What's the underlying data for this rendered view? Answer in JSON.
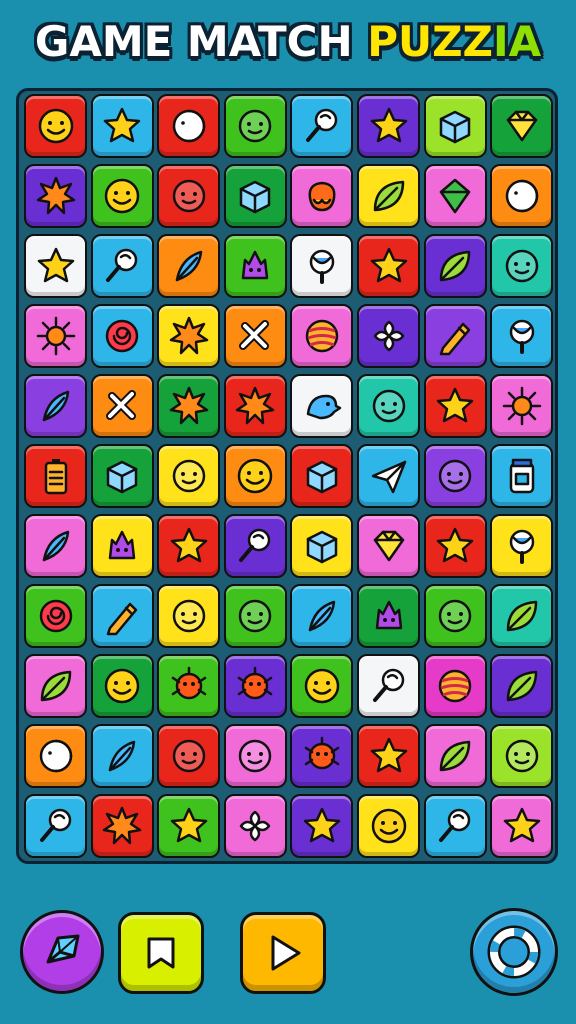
{
  "title": {
    "part1": "GAME MATCH ",
    "part2": "PUZZ",
    "part3": "IA"
  },
  "palette": {
    "red": "#e8261c",
    "sky": "#2fb6e8",
    "green": "#3fc11e",
    "dgreen": "#16a23a",
    "purple": "#6a2fd2",
    "violet": "#8a3fe0",
    "orange": "#ff8c12",
    "yellow": "#ffe21a",
    "pink": "#f06ad8",
    "white": "#f4f6f8",
    "lime": "#9be22a",
    "teal": "#22c6a8",
    "magenta": "#e63ac8"
  },
  "grid": [
    [
      [
        "red",
        "smiley"
      ],
      [
        "sky",
        "star"
      ],
      [
        "red",
        "moon"
      ],
      [
        "green",
        "face"
      ],
      [
        "sky",
        "lollipop"
      ],
      [
        "purple",
        "star"
      ],
      [
        "lime",
        "cube"
      ],
      [
        "dgreen",
        "gem"
      ]
    ],
    [
      [
        "purple",
        "burst"
      ],
      [
        "green",
        "smiley"
      ],
      [
        "red",
        "face"
      ],
      [
        "dgreen",
        "cube"
      ],
      [
        "pink",
        "blob"
      ],
      [
        "yellow",
        "leaf"
      ],
      [
        "pink",
        "diamond"
      ],
      [
        "orange",
        "moon"
      ]
    ],
    [
      [
        "white",
        "star"
      ],
      [
        "sky",
        "lollipop"
      ],
      [
        "orange",
        "feather"
      ],
      [
        "green",
        "monster"
      ],
      [
        "white",
        "candy"
      ],
      [
        "red",
        "star"
      ],
      [
        "purple",
        "leaf"
      ],
      [
        "teal",
        "face"
      ]
    ],
    [
      [
        "pink",
        "sun"
      ],
      [
        "sky",
        "swirl"
      ],
      [
        "yellow",
        "burst"
      ],
      [
        "orange",
        "cross"
      ],
      [
        "pink",
        "ball"
      ],
      [
        "purple",
        "flower"
      ],
      [
        "violet",
        "pencil"
      ],
      [
        "sky",
        "candy"
      ]
    ],
    [
      [
        "violet",
        "feather"
      ],
      [
        "orange",
        "cross"
      ],
      [
        "dgreen",
        "burst"
      ],
      [
        "red",
        "burst"
      ],
      [
        "white",
        "bird"
      ],
      [
        "teal",
        "face"
      ],
      [
        "red",
        "star"
      ],
      [
        "pink",
        "sun"
      ]
    ],
    [
      [
        "red",
        "battery"
      ],
      [
        "dgreen",
        "cube"
      ],
      [
        "yellow",
        "face"
      ],
      [
        "orange",
        "smiley"
      ],
      [
        "red",
        "cube"
      ],
      [
        "sky",
        "plane"
      ],
      [
        "violet",
        "face"
      ],
      [
        "sky",
        "jar"
      ]
    ],
    [
      [
        "pink",
        "feather"
      ],
      [
        "yellow",
        "monster"
      ],
      [
        "red",
        "star"
      ],
      [
        "purple",
        "lollipop"
      ],
      [
        "yellow",
        "cube"
      ],
      [
        "pink",
        "gem"
      ],
      [
        "red",
        "star"
      ],
      [
        "yellow",
        "candy"
      ]
    ],
    [
      [
        "green",
        "swirl"
      ],
      [
        "sky",
        "pencil"
      ],
      [
        "yellow",
        "face"
      ],
      [
        "green",
        "face"
      ],
      [
        "sky",
        "feather"
      ],
      [
        "dgreen",
        "monster"
      ],
      [
        "green",
        "face"
      ],
      [
        "teal",
        "leaf"
      ]
    ],
    [
      [
        "pink",
        "leaf"
      ],
      [
        "dgreen",
        "smiley"
      ],
      [
        "green",
        "bug"
      ],
      [
        "purple",
        "bug"
      ],
      [
        "green",
        "smiley"
      ],
      [
        "white",
        "lollipop"
      ],
      [
        "magenta",
        "ball"
      ],
      [
        "purple",
        "leaf"
      ]
    ],
    [
      [
        "orange",
        "moon"
      ],
      [
        "sky",
        "feather"
      ],
      [
        "red",
        "face"
      ],
      [
        "pink",
        "face"
      ],
      [
        "purple",
        "bug"
      ],
      [
        "red",
        "star"
      ],
      [
        "pink",
        "leaf"
      ],
      [
        "lime",
        "face"
      ]
    ],
    [
      [
        "sky",
        "lollipop"
      ],
      [
        "red",
        "burst"
      ],
      [
        "green",
        "star"
      ],
      [
        "pink",
        "flower"
      ],
      [
        "purple",
        "star"
      ],
      [
        "yellow",
        "smiley"
      ],
      [
        "sky",
        "lollipop"
      ],
      [
        "pink",
        "star"
      ]
    ]
  ],
  "controls": {
    "hint": {
      "icon": "diamond-icon",
      "color": "#b23ee8"
    },
    "back": {
      "icon": "flag-icon",
      "color": "#d8f000"
    },
    "play": {
      "icon": "play-icon",
      "color": "#ffb800"
    },
    "settings": {
      "icon": "ring-icon",
      "color": "#2b9fd8"
    }
  }
}
